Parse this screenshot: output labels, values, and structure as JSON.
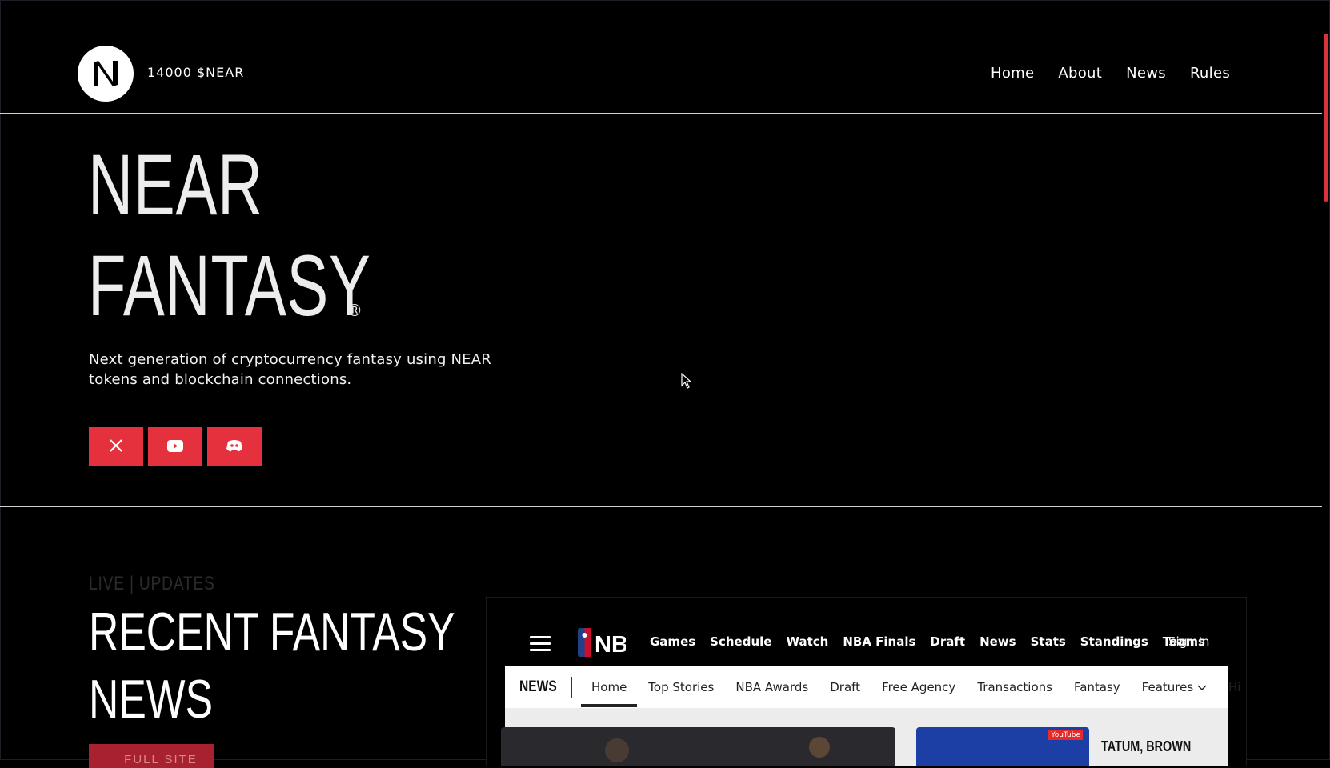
{
  "header": {
    "token_label": "14000 $NEAR",
    "nav": [
      "Home",
      "About",
      "News",
      "Rules"
    ]
  },
  "hero": {
    "title_line1": "NEAR",
    "title_line2": "FANTASY",
    "registered_mark": "®",
    "subtitle": "Next generation of cryptocurrency fantasy using NEAR tokens and blockchain connections.",
    "social_icons": [
      "x-icon",
      "youtube-icon",
      "discord-icon"
    ]
  },
  "news_section": {
    "kicker": "LIVE | UPDATES",
    "title_line1": "RECENT FANTASY",
    "title_line2": "NEWS",
    "button_label": "FULL SITE"
  },
  "embed": {
    "logo_text": "NBA",
    "primary_nav": [
      "Games",
      "Schedule",
      "Watch",
      "NBA Finals",
      "Draft",
      "News",
      "Stats",
      "Standings",
      "Teams"
    ],
    "sign_in": "Sign In",
    "section_label": "NEWS",
    "secondary_nav": [
      "Home",
      "Top Stories",
      "NBA Awards",
      "Draft",
      "Free Agency",
      "Transactions",
      "Fantasy",
      "Features",
      "Hi"
    ],
    "active_tab": "Home",
    "headline": "TATUM, BROWN",
    "thumb_badge": "YouTube"
  },
  "colors": {
    "accent": "#e5303d",
    "background": "#000000",
    "text": "#ffffff"
  }
}
